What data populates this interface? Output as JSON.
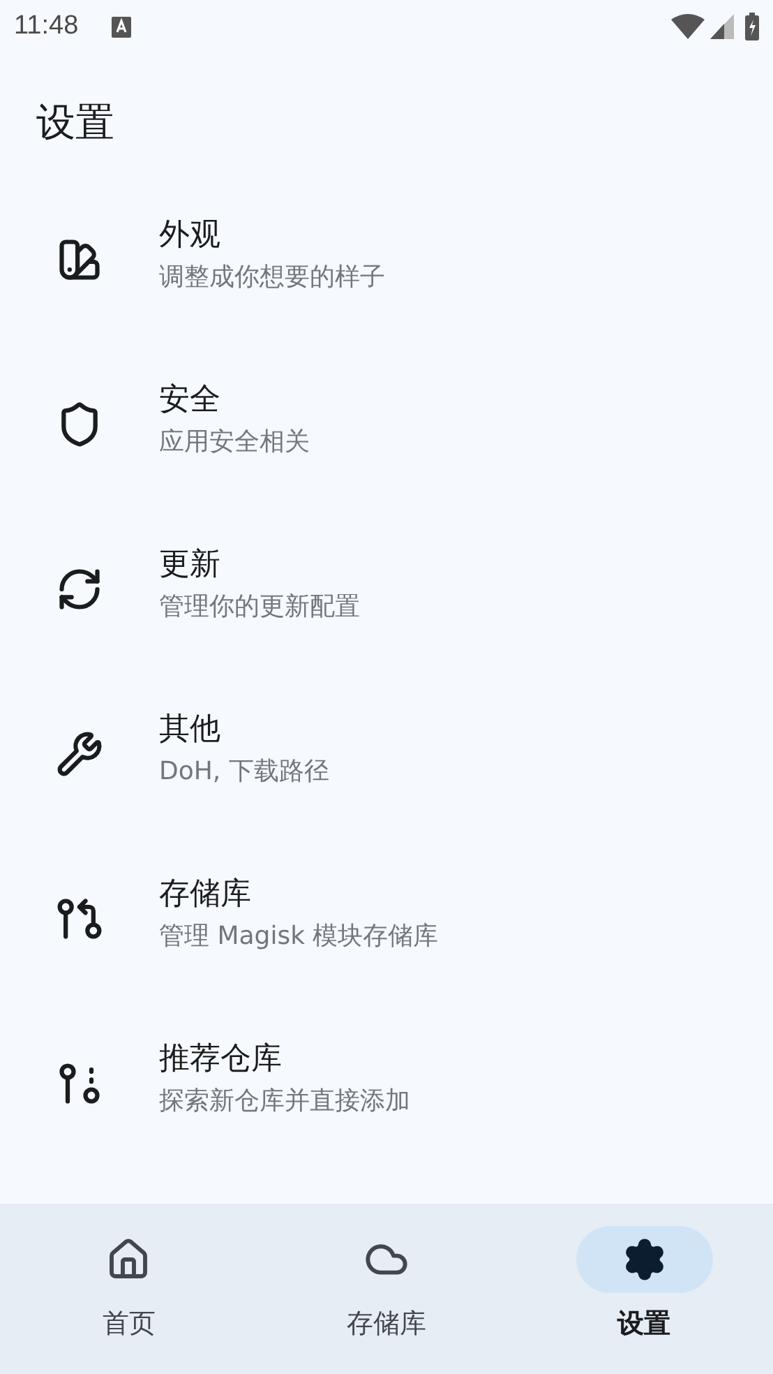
{
  "status_bar": {
    "time": "11:48"
  },
  "title": "设置",
  "settings": [
    {
      "title": "外观",
      "subtitle": "调整成你想要的样子"
    },
    {
      "title": "安全",
      "subtitle": "应用安全相关"
    },
    {
      "title": "更新",
      "subtitle": "管理你的更新配置"
    },
    {
      "title": "其他",
      "subtitle": "DoH, 下载路径"
    },
    {
      "title": "存储库",
      "subtitle": "管理 Magisk 模块存储库"
    },
    {
      "title": "推荐仓库",
      "subtitle": "探索新仓库并直接添加"
    }
  ],
  "bottom_nav": [
    {
      "label": "首页",
      "selected": false
    },
    {
      "label": "存储库",
      "selected": false
    },
    {
      "label": "设置",
      "selected": true
    }
  ]
}
